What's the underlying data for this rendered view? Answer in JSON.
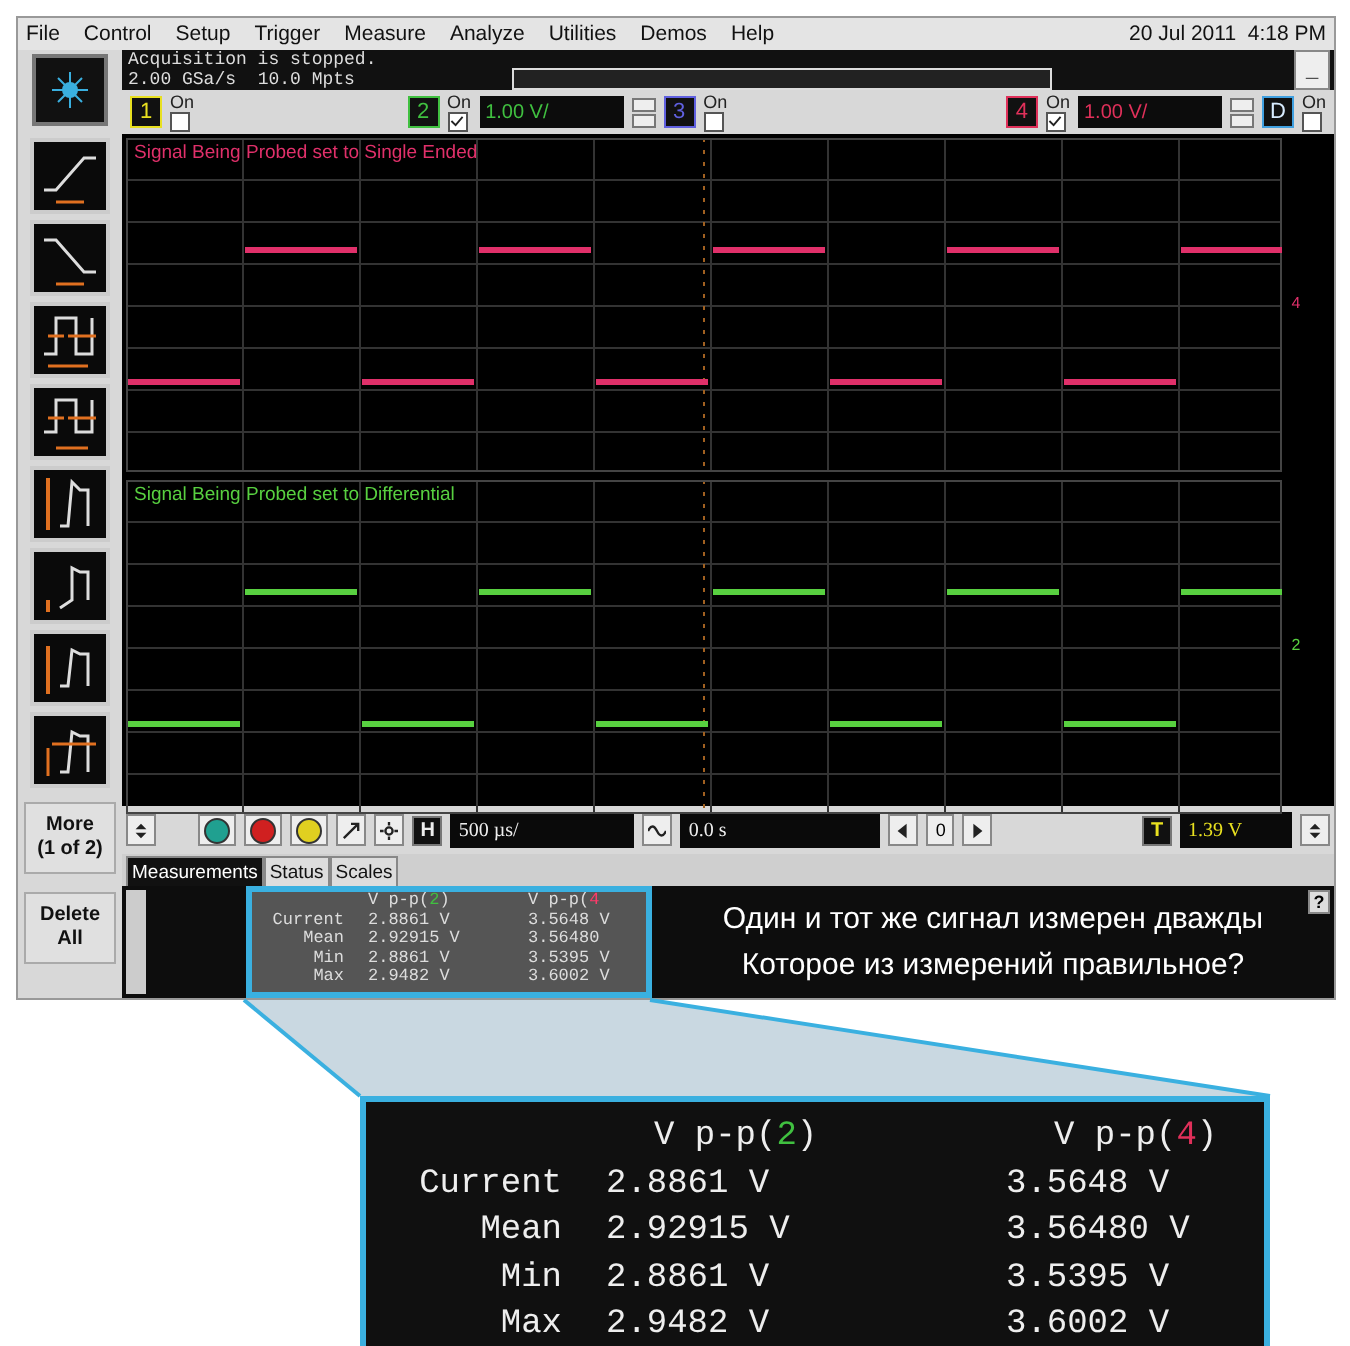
{
  "menu": [
    {
      "label": "File"
    },
    {
      "label": "Control"
    },
    {
      "label": "Setup"
    },
    {
      "label": "Trigger"
    },
    {
      "label": "Measure"
    },
    {
      "label": "Analyze"
    },
    {
      "label": "Utilities"
    },
    {
      "label": "Demos"
    },
    {
      "label": "Help"
    }
  ],
  "date": "20 Jul 2011",
  "time": "4:18 PM",
  "acquisition": {
    "status": "Acquisition is stopped.",
    "rate": "2.00 GSa/s",
    "memory": "10.0 Mpts"
  },
  "minimize": "_",
  "channels": [
    {
      "label": "1",
      "kind": "analog",
      "color": "#e8e020",
      "on_text": "On",
      "on": false
    },
    {
      "label": "2",
      "kind": "analog",
      "color": "#40c040",
      "on_text": "On",
      "on": true,
      "scale": "1.00 V/"
    },
    {
      "label": "3",
      "kind": "analog",
      "color": "#6060e0",
      "on_text": "On",
      "on": false
    },
    {
      "label": "4",
      "kind": "analog",
      "color": "#e0305a",
      "on_text": "On",
      "on": true,
      "scale": "1.00 V/"
    },
    {
      "label": "D",
      "kind": "digital",
      "color": "#40a0e0",
      "on_text": "On",
      "on": false
    }
  ],
  "panes": [
    {
      "label": "Signal Being Probed set to Single Ended",
      "color": "#e0306a",
      "marker": "4"
    },
    {
      "label": "Signal Being Probed set to Differential",
      "color": "#58d040",
      "marker": "2"
    }
  ],
  "controls": {
    "horizontal_key": "H",
    "timebase": "500 µs/",
    "delay": "0.0 s",
    "nav_value": "0",
    "trigger_key": "T",
    "trigger_level": "1.39 V"
  },
  "side_buttons": [
    {
      "lines": [
        "More",
        "(1 of 2)"
      ]
    },
    {
      "lines": [
        "Delete",
        "All"
      ]
    }
  ],
  "tabs": [
    {
      "label": "Measurements",
      "selected": true
    },
    {
      "label": "Status",
      "selected": false
    },
    {
      "label": "Scales",
      "selected": false
    }
  ],
  "measurements": {
    "headers": [
      {
        "prefix": "V p-p(",
        "channel": "2",
        "suffix": ")",
        "color": "#40c040"
      },
      {
        "prefix": "V p-p(",
        "channel": "4",
        "color": "#ff3a6a"
      }
    ],
    "rows": [
      {
        "name": "Current",
        "values": [
          "2.8861 V",
          "3.5648 V"
        ]
      },
      {
        "name": "Mean",
        "values": [
          "2.92915 V",
          "3.56480"
        ]
      },
      {
        "name": "Min",
        "values": [
          "2.8861 V",
          "3.5395 V"
        ]
      },
      {
        "name": "Max",
        "values": [
          "2.9482 V",
          "3.6002 V"
        ]
      }
    ]
  },
  "question": [
    "Один и тот же сигнал измерен дважды",
    "Которое из измерений правильное?"
  ],
  "help": "?",
  "callout": {
    "headers": [
      {
        "prefix": "V p-p(",
        "channel": "2",
        "suffix": ")",
        "color": "#40c040"
      },
      {
        "prefix": "V p-p(",
        "channel": "4",
        "suffix": ")",
        "color": "#e0305a"
      }
    ],
    "rows": [
      {
        "name": "Current",
        "values": [
          "2.8861 V",
          "3.5648 V"
        ]
      },
      {
        "name": "Mean",
        "values": [
          "2.92915 V",
          "3.56480 V"
        ]
      },
      {
        "name": "Min",
        "values": [
          "2.8861 V",
          "3.5395 V"
        ]
      },
      {
        "name": "Max",
        "values": [
          "2.9482 V",
          "3.6002 V"
        ]
      }
    ]
  }
}
